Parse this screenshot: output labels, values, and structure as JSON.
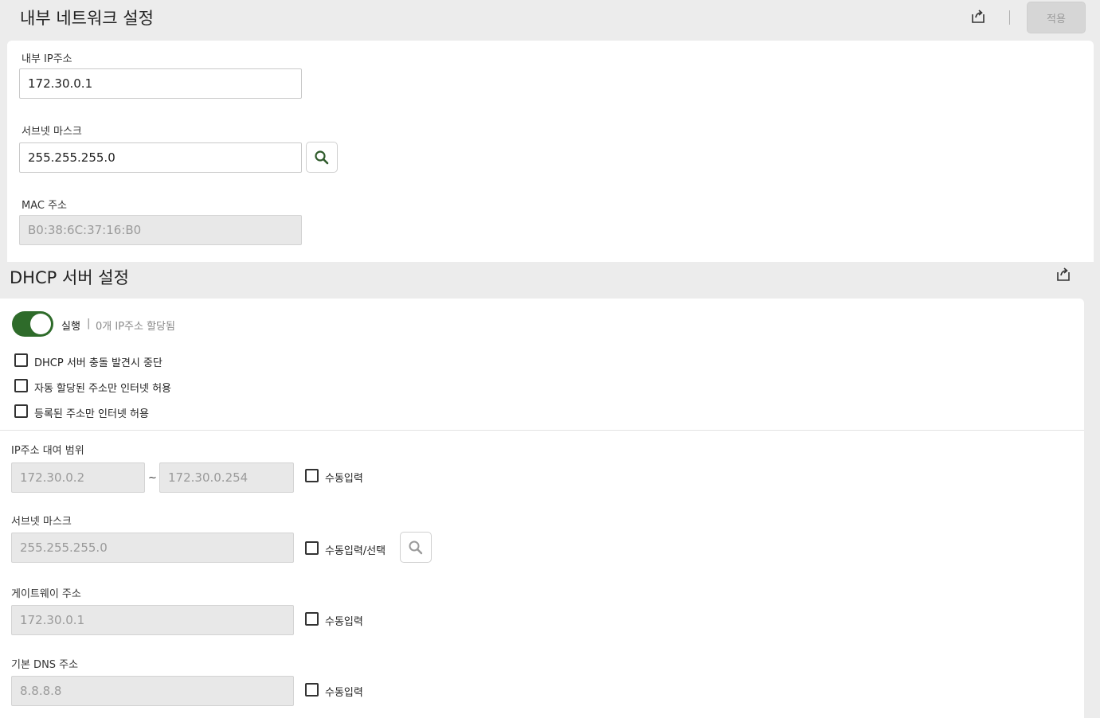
{
  "internal_network": {
    "title": "내부 네트워크 설정",
    "apply_label": "적용",
    "ip_label": "내부 IP주소",
    "ip_value": "172.30.0.1",
    "subnet_label": "서브넷 마스크",
    "subnet_value": "255.255.255.0",
    "mac_label": "MAC 주소",
    "mac_value": "B0:38:6C:37:16:B0"
  },
  "dhcp": {
    "title": "DHCP 서버 설정",
    "toggle_label": "실행",
    "separator": "|",
    "status": "0개 IP주소 할당됨",
    "toggle_on": true,
    "options": [
      {
        "label": "DHCP 서버 충돌 발견시 중단",
        "checked": false
      },
      {
        "label": "자동 할당된 주소만 인터넷 허용",
        "checked": false
      },
      {
        "label": "등록된 주소만 인터넷 허용",
        "checked": false
      }
    ],
    "range_label": "IP주소 대여 범위",
    "range_start": "172.30.0.2",
    "range_tilde": "~",
    "range_end": "172.30.0.254",
    "manual_label": "수동입력",
    "subnet_label": "서브넷 마스크",
    "subnet_value": "255.255.255.0",
    "manual_select_label": "수동입력/선택",
    "gateway_label": "게이트웨이 주소",
    "gateway_value": "172.30.0.1",
    "dns_label": "기본 DNS 주소",
    "dns_value": "8.8.8.8"
  },
  "colors": {
    "accent": "#2e6b2a",
    "background": "#ececec",
    "disabled_input": "#e8e8e8"
  },
  "icons": [
    "share-icon",
    "search-icon"
  ]
}
